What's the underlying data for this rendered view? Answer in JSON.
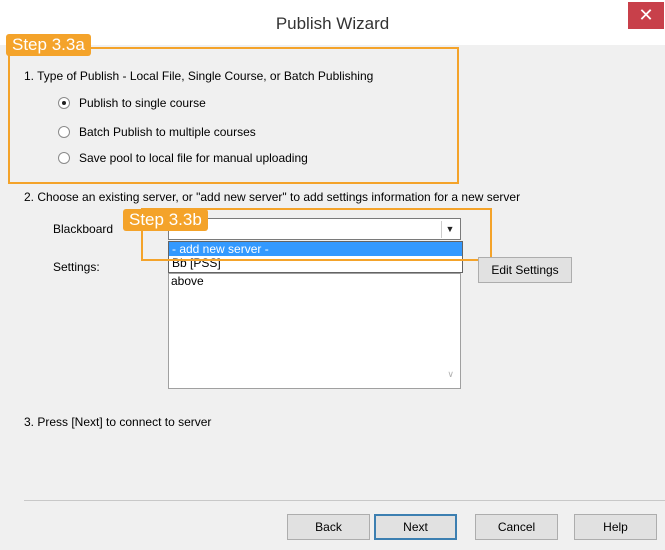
{
  "window": {
    "title": "Publish Wizard",
    "close_glyph": "✕"
  },
  "annotations": {
    "step_a": "Step 3.3a",
    "step_b": "Step 3.3b",
    "accent_color": "#f4a32a"
  },
  "section1": {
    "heading": "1. Type of Publish - Local File, Single Course, or Batch Publishing",
    "options": [
      {
        "label": "Publish to single course",
        "selected": true
      },
      {
        "label": "Batch Publish to multiple courses",
        "selected": false
      },
      {
        "label": "Save pool to local file for manual uploading",
        "selected": false
      }
    ]
  },
  "section2": {
    "heading": "2. Choose an existing server, or \"add new server\" to add settings information for a new server",
    "server_label": "Blackboard",
    "settings_label": "Settings:",
    "dropdown_options": [
      {
        "label": "- add new server -",
        "highlighted": true
      },
      {
        "label": "Bb [PSS]",
        "highlighted": false
      }
    ],
    "settings_text": "above",
    "edit_settings_label": "Edit Settings"
  },
  "section3": {
    "heading": "3. Press [Next] to connect to server"
  },
  "footer": {
    "back": "Back",
    "next": "Next",
    "cancel": "Cancel",
    "help": "Help"
  }
}
